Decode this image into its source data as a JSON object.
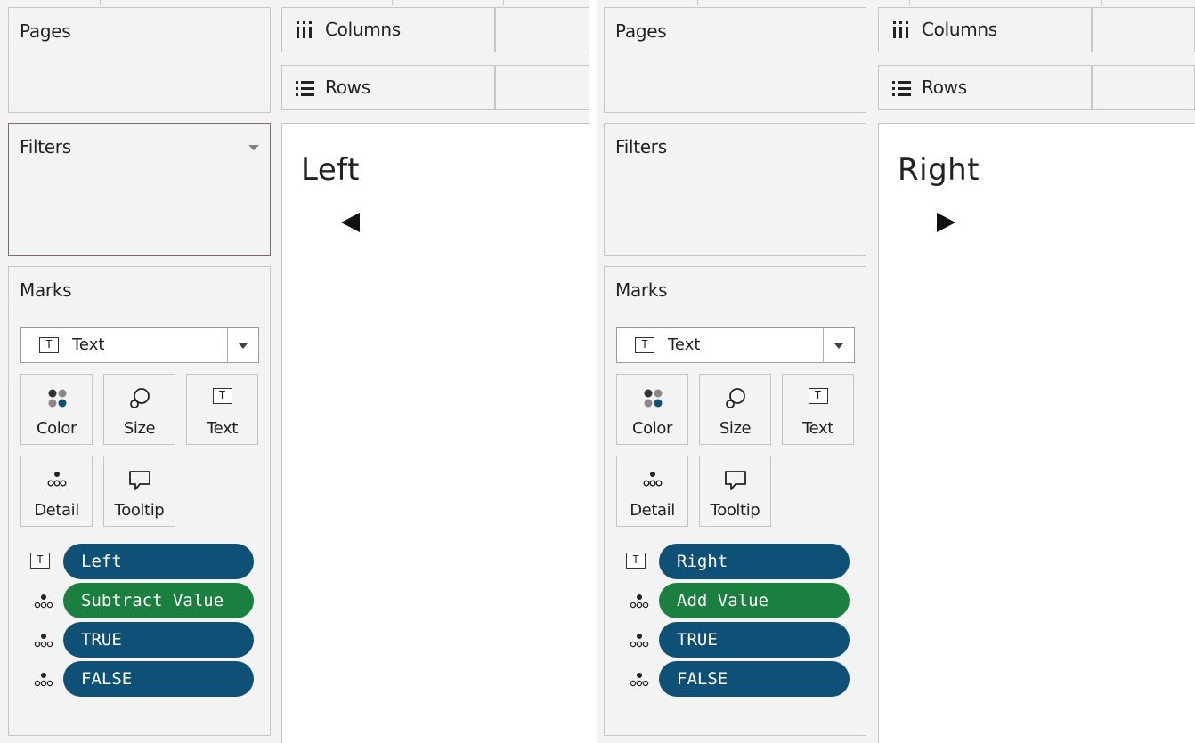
{
  "panels": [
    {
      "pages_title": "Pages",
      "filters_title": "Filters",
      "marks_title": "Marks",
      "mark_type": "Text",
      "tiles": {
        "color": "Color",
        "size": "Size",
        "text": "Text",
        "detail": "Detail",
        "tooltip": "Tooltip"
      },
      "columns_label": "Columns",
      "rows_label": "Rows",
      "canvas_title": "Left",
      "pills": [
        {
          "icon": "text-icon",
          "label": "Left",
          "color": "#0f5176"
        },
        {
          "icon": "detail-icon",
          "label": "Subtract Value",
          "color": "#1a7f3f"
        },
        {
          "icon": "detail-icon",
          "label": "TRUE",
          "color": "#0f5176"
        },
        {
          "icon": "detail-icon",
          "label": "FALSE",
          "color": "#0f5176"
        }
      ],
      "arrow": "left-arrow-icon"
    },
    {
      "pages_title": "Pages",
      "filters_title": "Filters",
      "marks_title": "Marks",
      "mark_type": "Text",
      "tiles": {
        "color": "Color",
        "size": "Size",
        "text": "Text",
        "detail": "Detail",
        "tooltip": "Tooltip"
      },
      "columns_label": "Columns",
      "rows_label": "Rows",
      "canvas_title": "Right",
      "pills": [
        {
          "icon": "text-icon",
          "label": "Right",
          "color": "#0f5176"
        },
        {
          "icon": "detail-icon",
          "label": "Add Value",
          "color": "#1a7f3f"
        },
        {
          "icon": "detail-icon",
          "label": "TRUE",
          "color": "#0f5176"
        },
        {
          "icon": "detail-icon",
          "label": "FALSE",
          "color": "#0f5176"
        }
      ],
      "arrow": "right-arrow-icon"
    }
  ]
}
